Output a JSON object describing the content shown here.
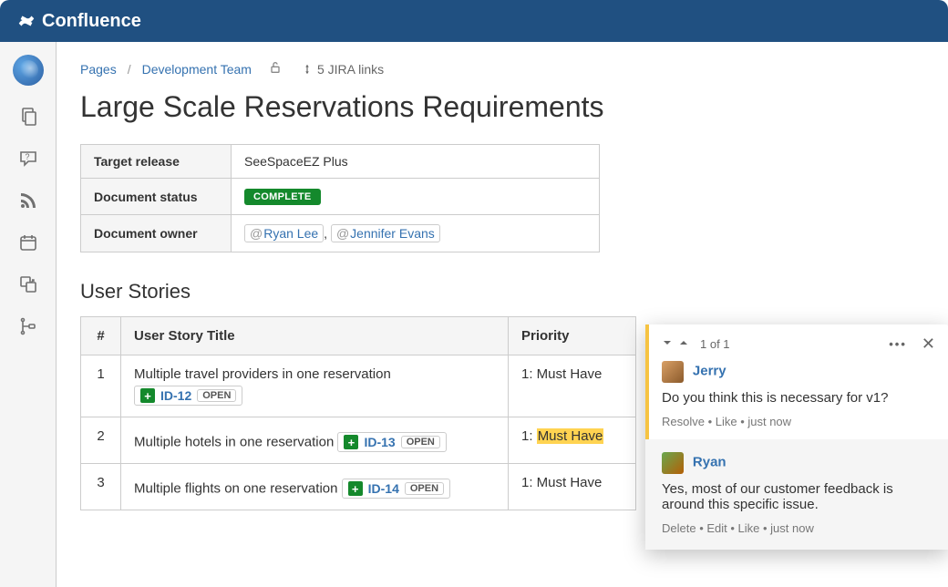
{
  "brand": "Confluence",
  "breadcrumb": {
    "root": "Pages",
    "space": "Development Team",
    "jira_links": "5 JIRA links"
  },
  "page_title": "Large Scale Reservations Requirements",
  "meta": {
    "target_release_label": "Target release",
    "target_release_value": "SeeSpaceEZ Plus",
    "status_label": "Document status",
    "status_value": "COMPLETE",
    "owner_label": "Document owner",
    "owner1": "Ryan Lee",
    "owner2": "Jennifer Evans"
  },
  "stories": {
    "heading": "User Stories",
    "col_num": "#",
    "col_title": "User Story Title",
    "col_priority": "Priority",
    "rows": [
      {
        "n": "1",
        "title": "Multiple travel providers in one reservation",
        "key": "ID-12",
        "state": "OPEN",
        "priority": "1: Must Have",
        "inline": false,
        "highlight": false
      },
      {
        "n": "2",
        "title": "Multiple hotels in one reservation",
        "key": "ID-13",
        "state": "OPEN",
        "priority_prefix": "1: ",
        "priority_hl": "Must Have",
        "inline": true,
        "highlight": true
      },
      {
        "n": "3",
        "title": "Multiple flights on one reservation",
        "key": "ID-14",
        "state": "OPEN",
        "priority": "1: Must Have",
        "inline": true,
        "highlight": false
      }
    ]
  },
  "comments": {
    "counter": "1 of 1",
    "thread": [
      {
        "author": "Jerry",
        "body": "Do you think this is necessary for v1?",
        "actions": "Resolve • Like • just now",
        "avatar": "linear-gradient(135deg,#d9a066,#8b5a2b)"
      },
      {
        "author": "Ryan",
        "body": "Yes, most of our customer feedback is around this specific issue.",
        "actions": "Delete • Edit • Like • just now",
        "avatar": "linear-gradient(135deg,#6aa84f,#b45f06)"
      }
    ]
  }
}
